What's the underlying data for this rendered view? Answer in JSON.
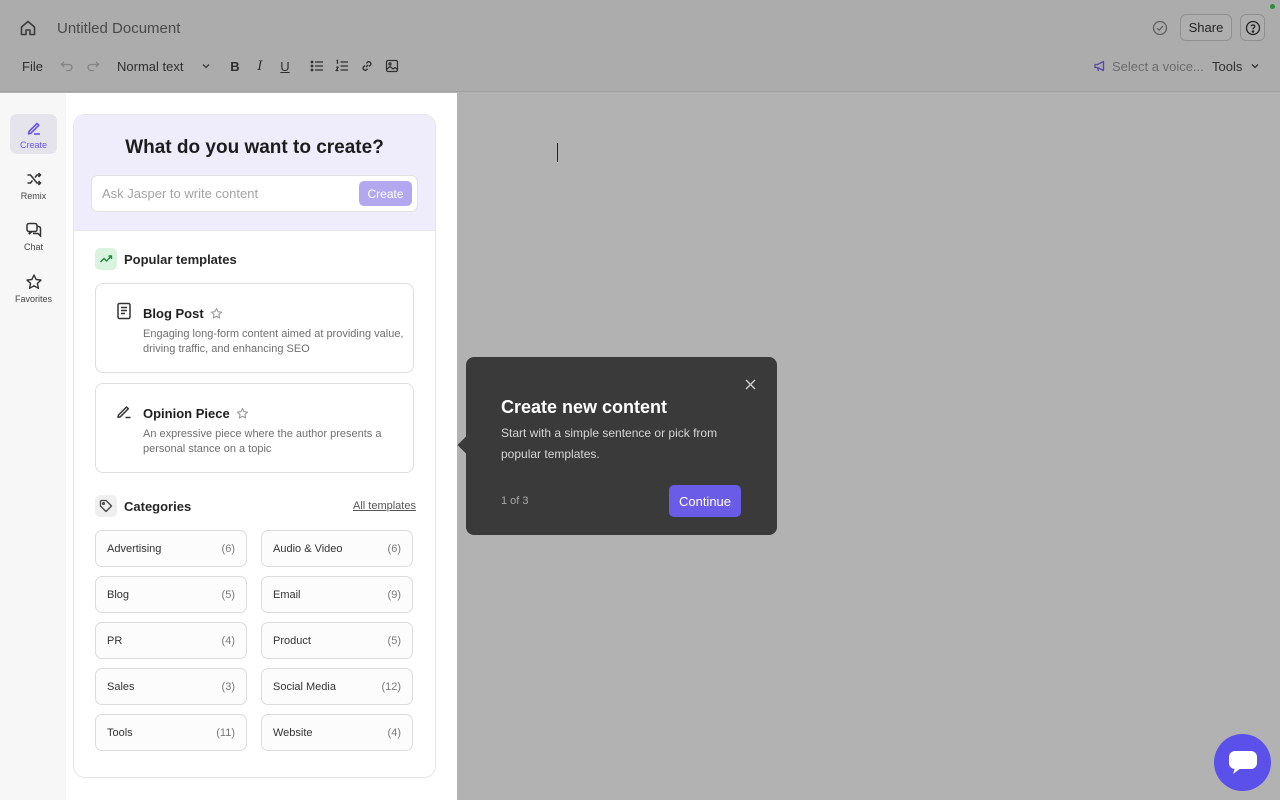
{
  "header": {
    "doc_title": "Untitled Document",
    "share_label": "Share"
  },
  "toolbar": {
    "file_label": "File",
    "text_style": "Normal text",
    "bold": "B",
    "italic": "I",
    "underline": "U",
    "voice_placeholder": "Select a voice...",
    "tools_label": "Tools"
  },
  "nav": {
    "items": [
      {
        "label": "Create",
        "icon": "pen-icon",
        "active": true
      },
      {
        "label": "Remix",
        "icon": "shuffle-icon"
      },
      {
        "label": "Chat",
        "icon": "chat-icon"
      },
      {
        "label": "Favorites",
        "icon": "star-icon"
      }
    ]
  },
  "panel": {
    "title": "What do you want to create?",
    "ask_placeholder": "Ask Jasper to write content",
    "ask_button": "Create",
    "popular_title": "Popular templates",
    "templates": [
      {
        "name": "Blog Post",
        "icon": "document-icon",
        "description": "Engaging long-form content aimed at providing value, driving traffic, and enhancing SEO"
      },
      {
        "name": "Opinion Piece",
        "icon": "pen-icon",
        "description": "An expressive piece where the author presents a personal stance on a topic"
      }
    ],
    "categories_title": "Categories",
    "all_templates": "All templates",
    "categories": [
      {
        "name": "Advertising",
        "count": "(6)"
      },
      {
        "name": "Audio & Video",
        "count": "(6)"
      },
      {
        "name": "Blog",
        "count": "(5)"
      },
      {
        "name": "Email",
        "count": "(9)"
      },
      {
        "name": "PR",
        "count": "(4)"
      },
      {
        "name": "Product",
        "count": "(5)"
      },
      {
        "name": "Sales",
        "count": "(3)"
      },
      {
        "name": "Social Media",
        "count": "(12)"
      },
      {
        "name": "Tools",
        "count": "(11)"
      },
      {
        "name": "Website",
        "count": "(4)"
      }
    ]
  },
  "tour": {
    "title": "Create new content",
    "body": "Start with a simple sentence or pick from popular templates.",
    "step": "1 of 3",
    "continue": "Continue"
  },
  "colors": {
    "accent": "#6b5ce7",
    "panel_head": "#efedfc",
    "tooltip_bg": "#3a3a3a",
    "fab": "#5b50ea"
  }
}
